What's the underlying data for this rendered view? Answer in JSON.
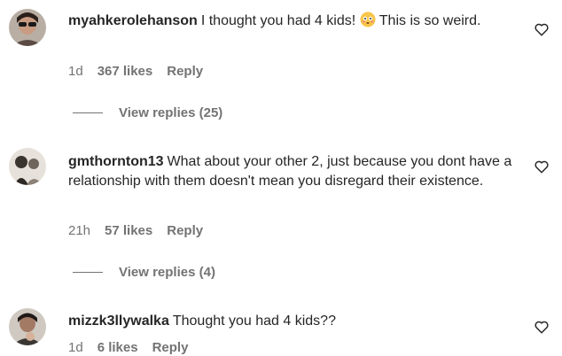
{
  "comments": [
    {
      "username": "myahkerolehanson",
      "text_before": "I thought you had 4 kids! ",
      "emoji": "flushed-face-emoji",
      "text_after": " This is so weird.",
      "time": "1d",
      "likes": "367 likes",
      "reply": "Reply",
      "view_replies": "View replies (25)"
    },
    {
      "username": "gmthornton13",
      "text": "What about your other 2, just because you dont have a relationship with them doesn't mean you disregard their existence.",
      "time": "21h",
      "likes": "57 likes",
      "reply": "Reply",
      "view_replies": "View replies (4)"
    },
    {
      "username": "mizzk3llywalka",
      "text": "Thought you had 4 kids??",
      "time": "1d",
      "likes": "6 likes",
      "reply": "Reply"
    }
  ],
  "icons": {
    "like": "heart-outline-icon"
  },
  "colors": {
    "text": "#262626",
    "secondary": "#737373"
  }
}
